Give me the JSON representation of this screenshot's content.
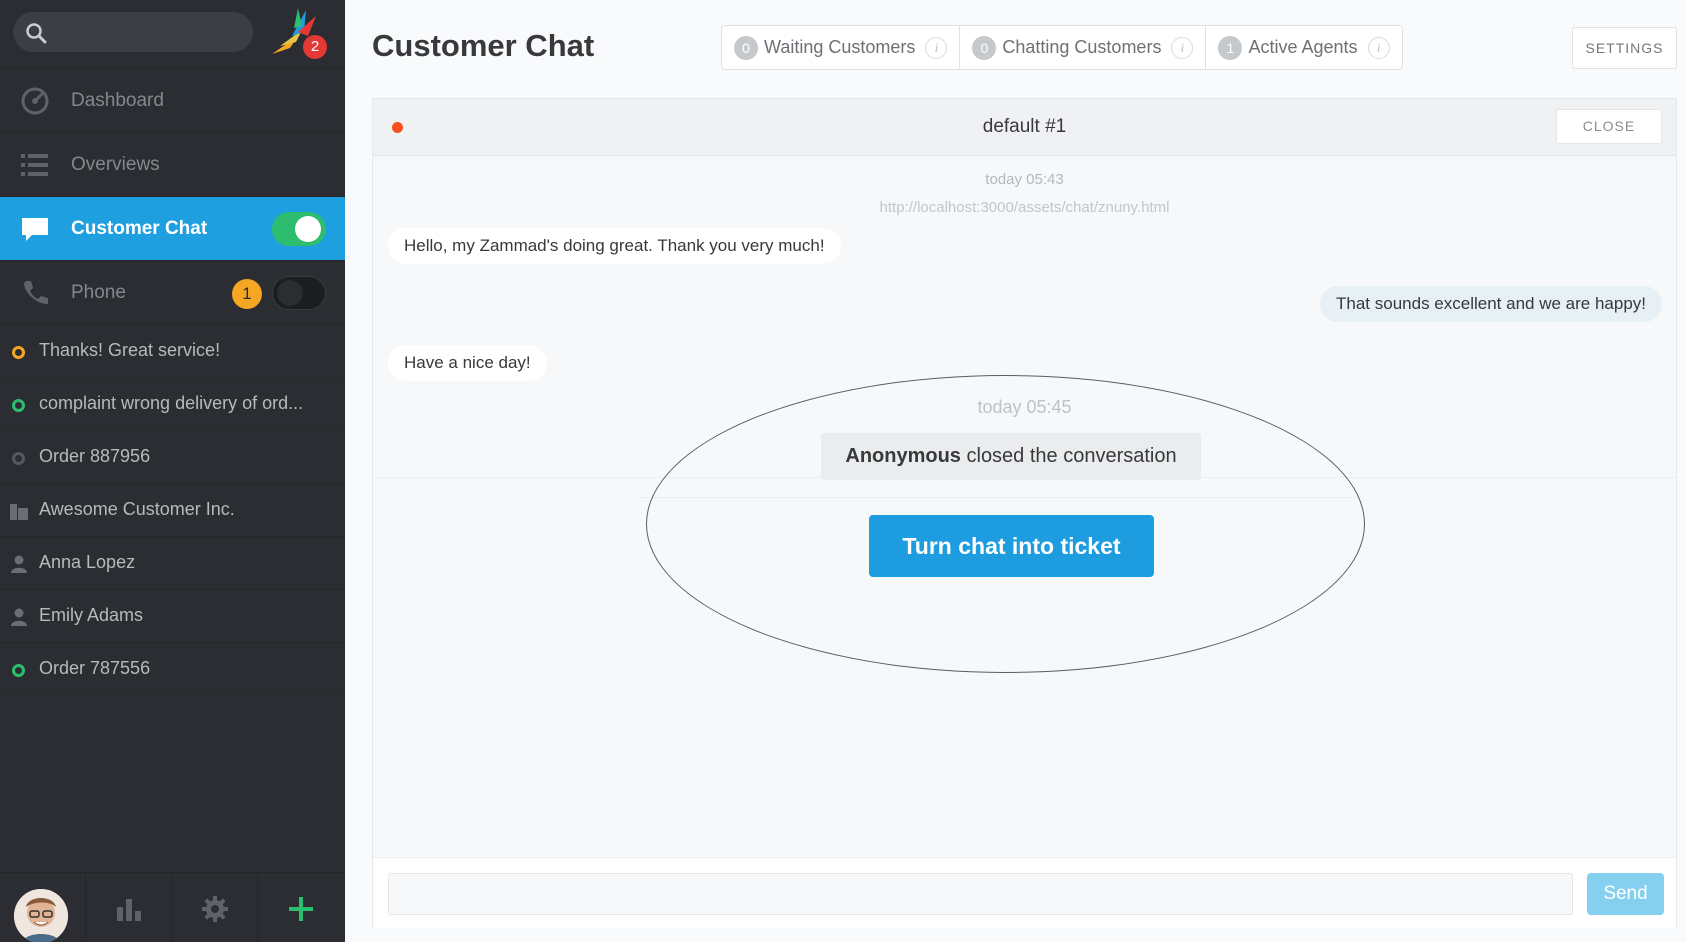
{
  "sidebar": {
    "search": {
      "placeholder": "",
      "value": ""
    },
    "logo_badge": "2",
    "nav": {
      "dashboard": "Dashboard",
      "overviews": "Overviews",
      "customer_chat": "Customer Chat",
      "phone": "Phone",
      "phone_badge": "1"
    },
    "tasks": [
      {
        "label": "Thanks! Great service!",
        "icon": "ring-orange-icon",
        "color": "#f5a623"
      },
      {
        "label": "complaint wrong delivery of ord...",
        "icon": "ring-green-icon",
        "color": "#2dbd6e"
      },
      {
        "label": "Order 887956",
        "icon": "ring-gray-icon",
        "color": "#55585d"
      },
      {
        "label": "Awesome Customer Inc.",
        "icon": "organization-icon"
      },
      {
        "label": "Anna Lopez",
        "icon": "user-icon"
      },
      {
        "label": "Emily Adams",
        "icon": "user-icon"
      },
      {
        "label": "Order 787556",
        "icon": "ring-green-icon",
        "color": "#2dbd6e"
      }
    ]
  },
  "header": {
    "title": "Customer Chat",
    "stats": [
      {
        "count": "0",
        "label": "Waiting Customers"
      },
      {
        "count": "0",
        "label": "Chatting Customers"
      },
      {
        "count": "1",
        "label": "Active Agents"
      }
    ],
    "info_glyph": "i",
    "settings_label": "SETTINGS"
  },
  "chat": {
    "name": "default #1",
    "close_label": "CLOSE",
    "start_time": "today 05:43",
    "url": "http://localhost:3000/assets/chat/znuny.html",
    "messages": [
      {
        "from": "customer",
        "text": "Hello, my Zammad's doing great. Thank you very much!"
      },
      {
        "from": "agent",
        "text": "That sounds excellent and we are happy!"
      },
      {
        "from": "customer",
        "text": "Have a nice day!"
      }
    ],
    "closed_time": "today 05:45",
    "closed_actor": "Anonymous",
    "closed_text": " closed the conversation",
    "turn_ticket_label": "Turn chat into ticket",
    "input_placeholder": "",
    "send_label": "Send"
  },
  "colors": {
    "accent": "#1e9ce0",
    "sidebar_bg": "#2b2d32",
    "toggle_on": "#2dbd6e",
    "status_dot": "#f4511e",
    "badge_orange": "#f5a623",
    "badge_red": "#e53935"
  }
}
